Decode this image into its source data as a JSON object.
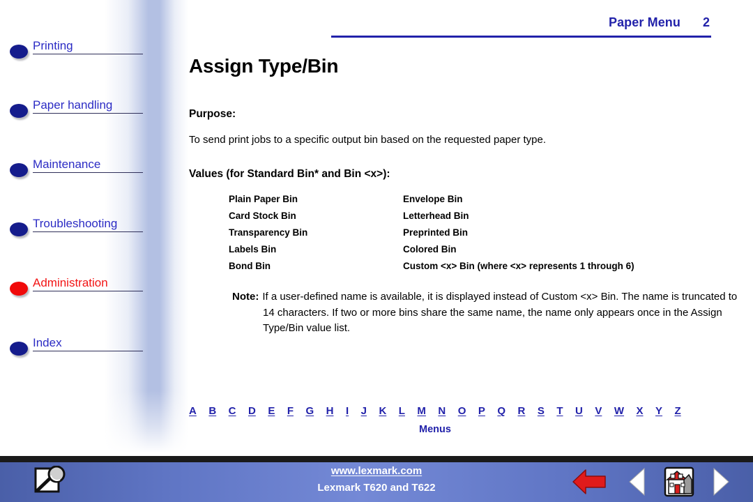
{
  "sidebar": {
    "items": [
      {
        "label": "Printing",
        "color": "#2B2BC4",
        "state": "normal"
      },
      {
        "label": "Paper handling",
        "color": "#2B2BC4",
        "state": "normal"
      },
      {
        "label": "Maintenance",
        "color": "#2B2BC4",
        "state": "normal"
      },
      {
        "label": "Troubleshooting",
        "color": "#2B2BC4",
        "state": "normal"
      },
      {
        "label": "Administration",
        "color": "#F21414",
        "state": "active"
      },
      {
        "label": "Index",
        "color": "#2B2BC4",
        "state": "normal"
      }
    ]
  },
  "header": {
    "title": "Paper Menu",
    "page_number": "2",
    "accent_color": "#2222AA"
  },
  "main": {
    "page_title": "Assign Type/Bin",
    "purpose_heading": "Purpose:",
    "purpose_text": "To send print jobs to a specific output bin based on the requested paper type.",
    "values_heading": "Values (for Standard Bin* and Bin <x>):",
    "values": [
      {
        "col1": "Plain Paper Bin",
        "col2": "Envelope Bin"
      },
      {
        "col1": "Card Stock Bin",
        "col2": "Letterhead Bin"
      },
      {
        "col1": "Transparency Bin",
        "col2": "Preprinted Bin"
      },
      {
        "col1": "Labels Bin",
        "col2": "Colored Bin"
      },
      {
        "col1": "Bond Bin",
        "col2": "Custom <x> Bin (where <x> represents 1 through 6)"
      }
    ],
    "note_label": "Note:",
    "note_text": "If a user-defined name is available, it is displayed instead of Custom <x> Bin. The name is truncated to 14 characters. If two or more bins share the same name, the name only appears once in the Assign Type/Bin value list."
  },
  "alpha_index": {
    "letters": [
      "A",
      "B",
      "C",
      "D",
      "E",
      "F",
      "G",
      "H",
      "I",
      "J",
      "K",
      "L",
      "M",
      "N",
      "O",
      "P",
      "Q",
      "R",
      "S",
      "T",
      "U",
      "V",
      "W",
      "X",
      "Y",
      "Z"
    ],
    "menus_label": "Menus"
  },
  "footer": {
    "url": "www.lexmark.com",
    "model": "Lexmark T620 and T622",
    "icons": {
      "search": "search-magnifier-icon",
      "back": "red-back-arrow-icon",
      "previous": "previous-page-triangle-icon",
      "home": "home-house-icon",
      "next": "next-page-triangle-icon"
    }
  }
}
